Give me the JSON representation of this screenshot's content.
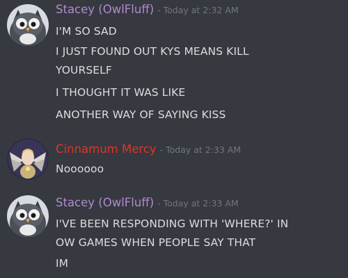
{
  "messages": [
    {
      "username": "Stacey (OwlFluff)",
      "username_color": "#b28ad1",
      "timestamp": "- Today at 2:32 AM",
      "avatar_icon": "owl-avatar-icon",
      "lines": [
        "I'M SO SAD",
        "I JUST FOUND OUT KYS MEANS KILL",
        "YOURSELF",
        "I THOUGHT IT WAS LIKE",
        "ANOTHER WAY OF SAYING KISS"
      ]
    },
    {
      "username": "Cinnamum Mercy",
      "username_color": "#e0332c",
      "timestamp": "- Today at 2:33 AM",
      "avatar_icon": "mercy-avatar-icon",
      "lines": [
        "Noooooo"
      ]
    },
    {
      "username": "Stacey (OwlFluff)",
      "username_color": "#b28ad1",
      "timestamp": "- Today at 2:33 AM",
      "avatar_icon": "owl-avatar-icon",
      "lines": [
        "I'VE BEEN RESPONDING WITH 'WHERE?' IN",
        "OW GAMES WHEN PEOPLE SAY THAT",
        "IM"
      ]
    }
  ]
}
